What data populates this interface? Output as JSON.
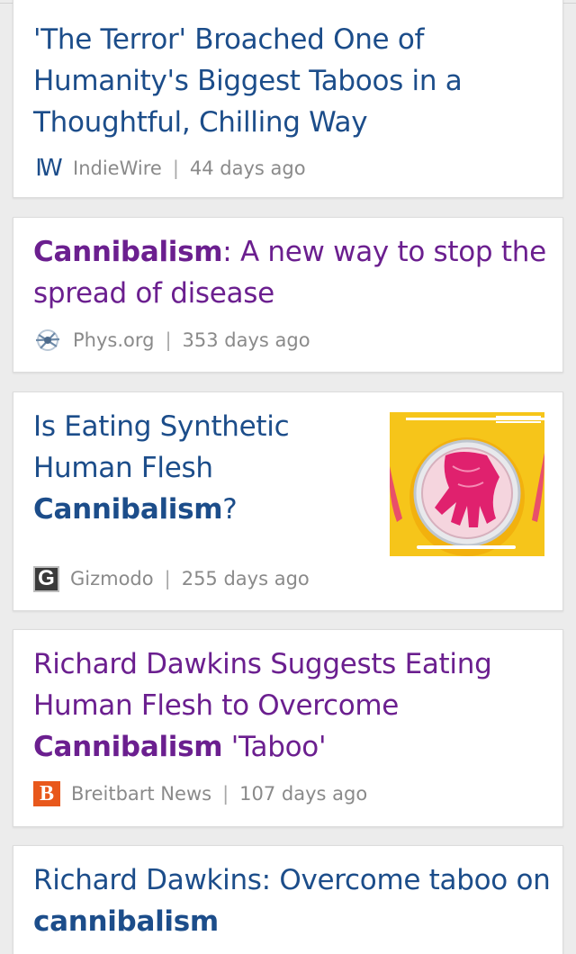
{
  "articles": [
    {
      "title_parts": [
        "'The Terror' Broached One of Humanity's Biggest Taboos in a Thoughtful, Chilling Way"
      ],
      "source": "IndieWire",
      "separator": "|",
      "age": "44 days ago",
      "logo": "IW",
      "visited": false
    },
    {
      "keyword": "Cannibalism",
      "rest": ": A new way to stop the spread of disease",
      "source": "Phys.org",
      "separator": "|",
      "age": "353 days ago",
      "logo_icon": "physorg-logo-icon",
      "visited": true
    },
    {
      "pre": "Is Eating Synthetic Human Flesh",
      "keyword": "Cannibalism",
      "post": "?",
      "source": "Gizmodo",
      "separator": "|",
      "age": "255 days ago",
      "logo": "G",
      "thumbnail_icon": "synthetic-hand-petri-dish-image",
      "visited": false
    },
    {
      "pre": "Richard Dawkins Suggests Eating Human Flesh to Overcome",
      "keyword": "Cannibalism",
      "post": " 'Taboo'",
      "source": "Breitbart News",
      "separator": "|",
      "age": "107 days ago",
      "logo": "B",
      "visited": true
    },
    {
      "pre": "Richard Dawkins: Overcome taboo on",
      "keyword": "cannibalism",
      "visited": false
    }
  ],
  "colors": {
    "link": "#1c4d8a",
    "visited": "#6b1f8f",
    "meta": "#8a8a8a",
    "background": "#ececec",
    "card": "#ffffff"
  }
}
